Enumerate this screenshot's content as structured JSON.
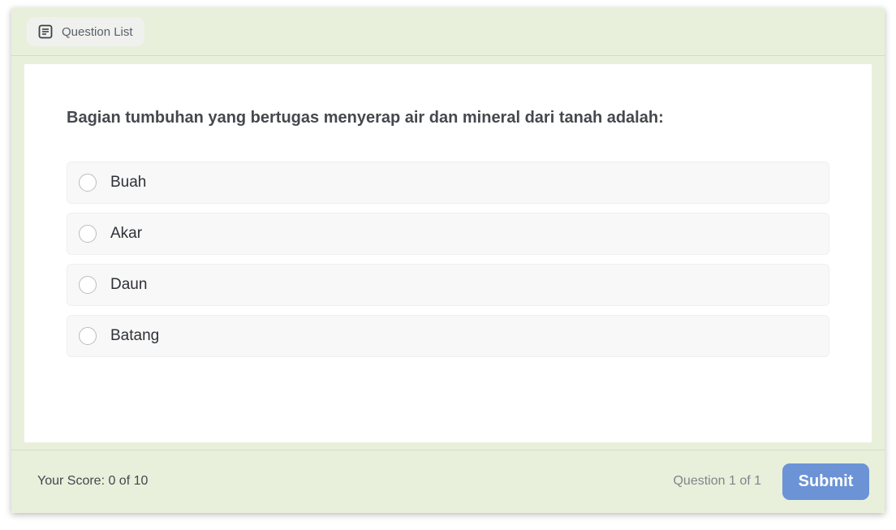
{
  "header": {
    "question_list_label": "Question List",
    "question_list_icon": "document-list-icon"
  },
  "question": {
    "text": "Bagian tumbuhan yang bertugas menyerap air dan mineral dari tanah adalah:",
    "options": [
      {
        "label": "Buah"
      },
      {
        "label": "Akar"
      },
      {
        "label": "Daun"
      },
      {
        "label": "Batang"
      }
    ]
  },
  "footer": {
    "score_text": "Your Score: 0 of 10",
    "progress_text": "Question 1 of 1",
    "submit_label": "Submit"
  },
  "colors": {
    "card_background": "#e8f0dc",
    "submit_button": "#6b93d6",
    "panel_background": "#ffffff"
  }
}
